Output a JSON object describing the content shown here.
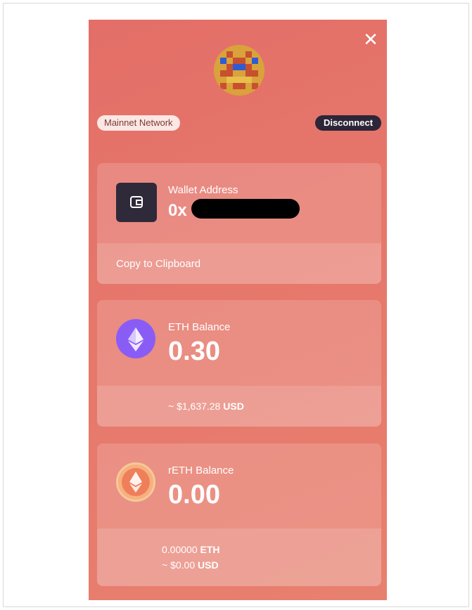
{
  "header": {
    "close_label": "✕",
    "network_label": "Mainnet Network",
    "disconnect_label": "Disconnect"
  },
  "wallet": {
    "label": "Wallet Address",
    "address_prefix": "0x",
    "copy_label": "Copy to Clipboard"
  },
  "eth": {
    "label": "ETH Balance",
    "amount": "0.30",
    "usd_prefix": "~ $1,637.28",
    "usd_unit": "USD"
  },
  "reth": {
    "label": "rETH Balance",
    "amount": "0.00",
    "eth_value": "0.00000",
    "eth_unit": "ETH",
    "usd_prefix": "~ $0.00",
    "usd_unit": "USD"
  },
  "colors": {
    "panel": "#e36f68",
    "dark": "#2d2638",
    "eth_icon": "#8a5cf6",
    "reth_icon": "#f29a6b"
  },
  "icons": {
    "close": "close-icon",
    "wallet": "wallet-icon",
    "eth": "ethereum-icon",
    "reth": "reth-icon",
    "avatar": "identicon-avatar"
  }
}
